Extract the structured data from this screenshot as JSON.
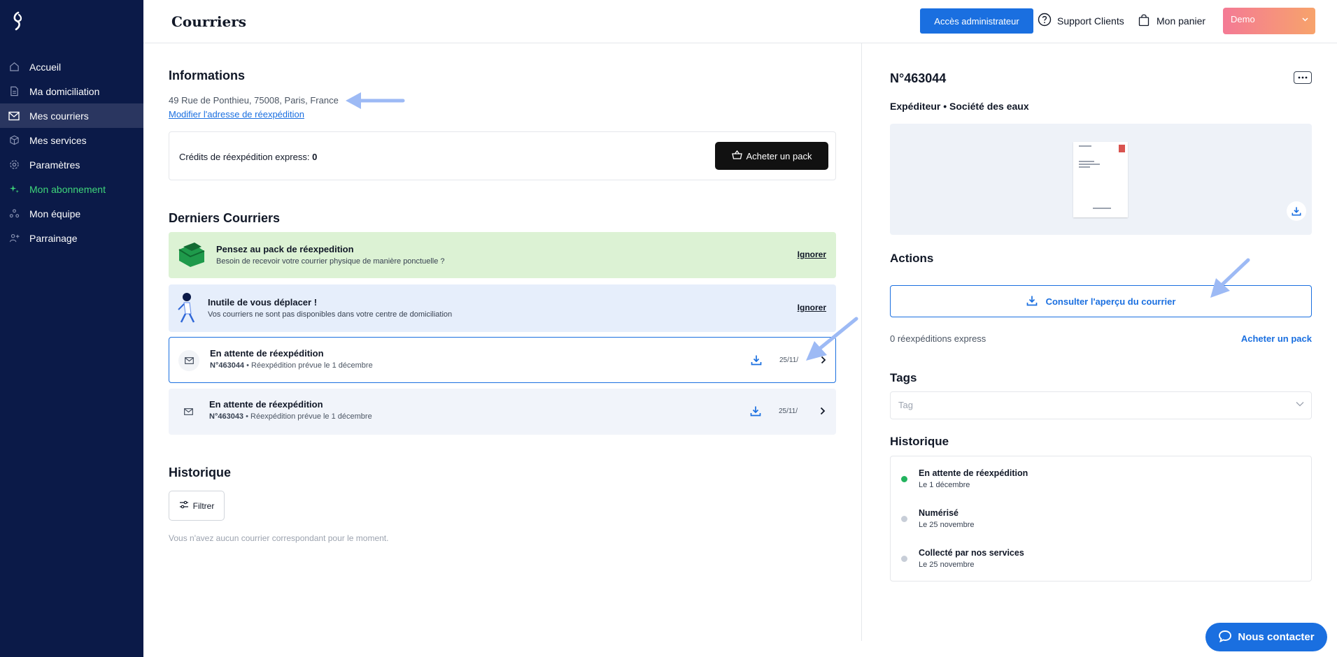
{
  "header": {
    "title": "Courriers",
    "admin_label": "Accès administrateur",
    "support_label": "Support Clients",
    "cart_label": "Mon panier",
    "account_label": "Demo"
  },
  "sidebar": {
    "items": [
      {
        "label": "Accueil",
        "icon": "home-icon"
      },
      {
        "label": "Ma domiciliation",
        "icon": "document-icon"
      },
      {
        "label": "Mes courriers",
        "icon": "mail-icon",
        "active": true
      },
      {
        "label": "Mes services",
        "icon": "box-icon"
      },
      {
        "label": "Paramètres",
        "icon": "gear-icon"
      },
      {
        "label": "Mon abonnement",
        "icon": "sparkle-icon",
        "highlight": "#3fd67a"
      },
      {
        "label": "Mon équipe",
        "icon": "team-icon"
      },
      {
        "label": "Parrainage",
        "icon": "referral-icon"
      }
    ]
  },
  "info": {
    "title": "Informations",
    "address": "49 Rue de Ponthieu, 75008, Paris, France",
    "modify_link": "Modifier l'adresse de réexpédition",
    "credits_label": "Crédits de réexpédition express:",
    "credits_value": "0",
    "buy_pack_label": "Acheter un pack"
  },
  "latest": {
    "title": "Derniers Courriers",
    "banners": [
      {
        "title": "Pensez au pack de réexpedition",
        "subtitle": "Besoin de recevoir votre courrier physique de manière ponctuelle ?",
        "action": "Ignorer"
      },
      {
        "title": "Inutile de vous déplacer !",
        "subtitle": "Vos courriers ne sont pas disponibles dans votre centre de domiciliation",
        "action": "Ignorer"
      }
    ],
    "mails": [
      {
        "status": "En attente de réexpédition",
        "number": "N°463044",
        "detail": "Réexpédition prévue le 1 décembre",
        "date": "25/11/",
        "selected": true
      },
      {
        "status": "En attente de réexpédition",
        "number": "N°463043",
        "detail": "Réexpédition prévue le 1 décembre",
        "date": "25/11/",
        "selected": false
      }
    ]
  },
  "history": {
    "title": "Historique",
    "filter_label": "Filtrer",
    "empty_text": "Vous n'avez aucun courrier correspondant pour le moment."
  },
  "detail": {
    "number": "N°463044",
    "sender": "Expéditeur • Société des eaux",
    "actions_title": "Actions",
    "preview_button": "Consulter l'aperçu du courrier",
    "express_count": "0 réexpéditions express",
    "buy_pack_link": "Acheter un pack",
    "tags_title": "Tags",
    "tag_placeholder": "Tag",
    "history_title": "Historique",
    "timeline": [
      {
        "title": "En attente de réexpédition",
        "date": "Le 1 décembre",
        "color": "#22b35e"
      },
      {
        "title": "Numérisé",
        "date": "Le 25 novembre",
        "color": "#c8ced8"
      },
      {
        "title": "Collecté par nos services",
        "date": "Le 25 novembre",
        "color": "#c8ced8"
      }
    ]
  },
  "contact_label": "Nous contacter",
  "colors": {
    "sidebar": "#0b1a48",
    "accent": "#1a6fe0",
    "green_banner": "#dcf2d4",
    "blue_banner": "#e6eefb",
    "annotation_arrow": "#9dbaf5"
  }
}
